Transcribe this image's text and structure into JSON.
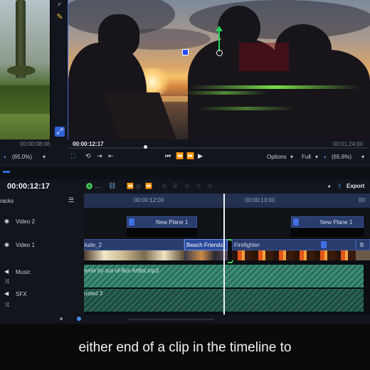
{
  "viewer": {
    "left_timecode": "00:00:08:06",
    "left_zoom": "(65.0%)",
    "main_timecode": "00:00:12:17",
    "main_end_timecode": "00:01:24:00",
    "options_label": "Options",
    "quality_label": "Full",
    "main_zoom": "(65.6%)"
  },
  "timeline": {
    "current_timecode": "00:00:12:17",
    "export_label": "Export",
    "tracks_label": "racks",
    "ruler_ticks": [
      "00:00:12:00",
      "00:00:13:00",
      "00"
    ],
    "tracks": [
      {
        "name": "Video 2"
      },
      {
        "name": "Video 1"
      },
      {
        "name": "Music"
      },
      {
        "name": "SFX"
      }
    ],
    "clips": {
      "v2_a": "New Plane 1",
      "v2_b": "New Plane 1",
      "v1_a": "kate_2",
      "v1_b": "Beach Friends",
      "v1_c": "Firefighter",
      "v1_d": "B",
      "music": "emix by out-of-flux Artlist.mp3",
      "sfx": "usted 3"
    }
  },
  "caption": {
    "text": "either end of a clip in the timeline to"
  },
  "colors": {
    "accent": "#4f8df5",
    "audio": "#3e8f78",
    "clip": "#283c6e"
  }
}
